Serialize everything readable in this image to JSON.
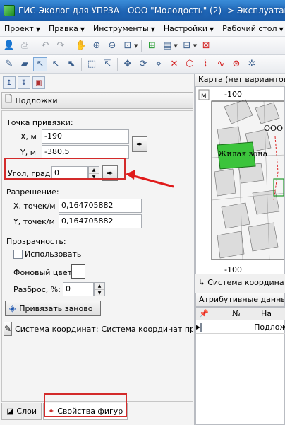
{
  "window": {
    "title": "ГИС Эколог для УПРЗА - ООО \"Молодость\" (2) -> Эксплуатация предп"
  },
  "menu": [
    "Проект",
    "Правка",
    "Инструменты",
    "Настройки",
    "Рабочий стол",
    "?"
  ],
  "left_panel": {
    "header": "Подложки",
    "anchor_label": "Точка привязки:",
    "x_label": "X, м",
    "x_value": "-190",
    "y_label": "Y, м",
    "y_value": "-380,5",
    "angle_label": "Угол, град.",
    "angle_value": "0",
    "resolution_label": "Разрешение:",
    "res_x_label": "X, точек/м",
    "res_x_value": "0,164705882",
    "res_y_label": "Y, точек/м",
    "res_y_value": "0,164705882",
    "transparency_label": "Прозрачность:",
    "use_label": "Использовать",
    "bg_color_label": "Фоновый цвет",
    "spread_label": "Разброс, %:",
    "spread_value": "0",
    "rebind_label": "Привязать заново",
    "coord_system_label": "Система координат:",
    "coord_system_value": "Система координат про..."
  },
  "bottom_tabs": {
    "layers": "Слои",
    "shape_props": "Свойства фигур"
  },
  "map": {
    "header": "Карта (нет вариантов рас",
    "m_label": "м",
    "top_tick": "-100",
    "bottom_tick": "-100",
    "label_zone": "Жилая зона",
    "label_ooo": "ООО",
    "coord_status": "Система координат"
  },
  "attr": {
    "header": "Атрибутивные данные т",
    "col_num": "№",
    "col_name": "На",
    "row1_name": "Подлож"
  },
  "colors": {
    "highlight": "#d32a2a",
    "arrow": "#e01b1b",
    "zone_green": "#3cc43c"
  }
}
